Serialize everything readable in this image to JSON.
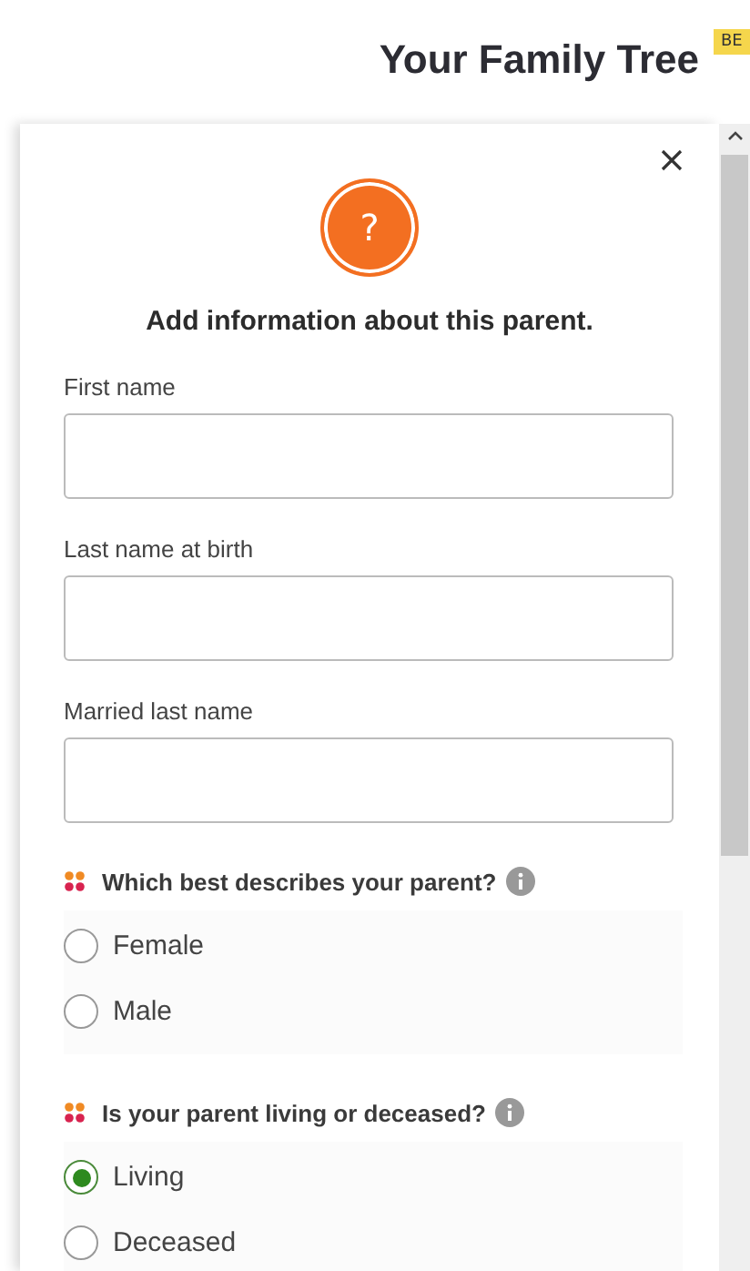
{
  "header": {
    "title": "Your Family Tree",
    "badge": "BE"
  },
  "dialog": {
    "avatar_symbol": "?",
    "heading": "Add information about this parent.",
    "fields": [
      {
        "label": "First name"
      },
      {
        "label": "Last name at birth"
      },
      {
        "label": "Married last name"
      }
    ],
    "questions": [
      {
        "text": "Which best describes your parent?",
        "options": [
          {
            "label": "Female",
            "selected": false
          },
          {
            "label": "Male",
            "selected": false
          }
        ]
      },
      {
        "text": "Is your parent living or deceased?",
        "options": [
          {
            "label": "Living",
            "selected": true
          },
          {
            "label": "Deceased",
            "selected": false
          }
        ]
      }
    ]
  }
}
